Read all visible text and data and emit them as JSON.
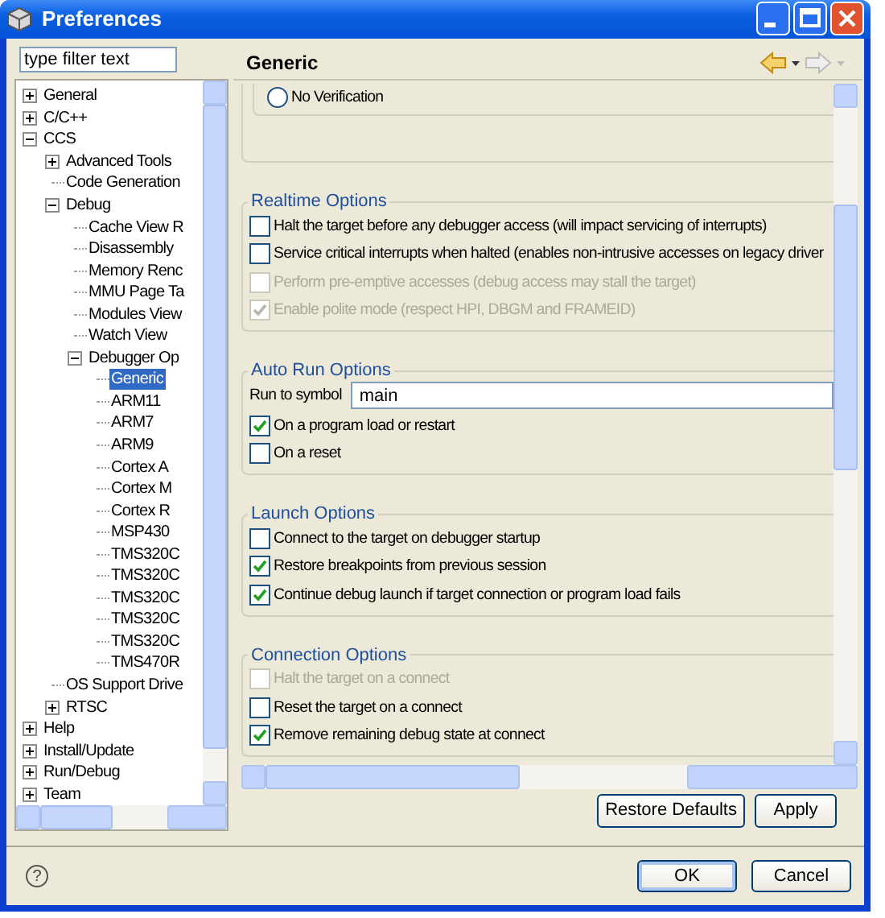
{
  "window": {
    "title": "Preferences"
  },
  "filter": {
    "value": "type filter text"
  },
  "tree": [
    {
      "label": "General",
      "expanded": false,
      "selected": false
    },
    {
      "label": "C/C++",
      "expanded": false,
      "selected": false
    },
    {
      "label": "CCS",
      "expanded": true,
      "selected": false,
      "children": [
        {
          "label": "Advanced Tools",
          "expanded": false,
          "selected": false
        },
        {
          "label": "Code Generation",
          "selected": false
        },
        {
          "label": "Debug",
          "expanded": true,
          "selected": false,
          "children": [
            {
              "label": "Cache View R",
              "selected": false
            },
            {
              "label": "Disassembly",
              "selected": false
            },
            {
              "label": "Memory Renc",
              "selected": false
            },
            {
              "label": "MMU Page Ta",
              "selected": false
            },
            {
              "label": "Modules View",
              "selected": false
            },
            {
              "label": "Watch View",
              "selected": false
            },
            {
              "label": "Debugger Op",
              "expanded": true,
              "selected": false,
              "children": [
                {
                  "label": "Generic",
                  "selected": true
                },
                {
                  "label": "ARM11",
                  "selected": false
                },
                {
                  "label": "ARM7",
                  "selected": false
                },
                {
                  "label": "ARM9",
                  "selected": false
                },
                {
                  "label": "Cortex A",
                  "selected": false
                },
                {
                  "label": "Cortex M",
                  "selected": false
                },
                {
                  "label": "Cortex R",
                  "selected": false
                },
                {
                  "label": "MSP430",
                  "selected": false
                },
                {
                  "label": "TMS320C",
                  "selected": false
                },
                {
                  "label": "TMS320C",
                  "selected": false
                },
                {
                  "label": "TMS320C",
                  "selected": false
                },
                {
                  "label": "TMS320C",
                  "selected": false
                },
                {
                  "label": "TMS320C",
                  "selected": false
                },
                {
                  "label": "TMS470R",
                  "selected": false
                }
              ]
            }
          ]
        },
        {
          "label": "OS Support Drive",
          "selected": false
        },
        {
          "label": "RTSC",
          "expanded": false,
          "selected": false
        }
      ]
    },
    {
      "label": "Help",
      "expanded": false,
      "selected": false
    },
    {
      "label": "Install/Update",
      "expanded": false,
      "selected": false
    },
    {
      "label": "Run/Debug",
      "expanded": false,
      "selected": false
    },
    {
      "label": "Team",
      "expanded": false,
      "selected": false
    }
  ],
  "page": {
    "title": "Generic"
  },
  "groups": [
    {
      "items": [
        {
          "kind": "radio",
          "label": "No Verification",
          "selected": false
        }
      ]
    },
    {
      "title": "Realtime Options",
      "items": [
        {
          "kind": "checkbox",
          "label": "Halt the target before any debugger access (will impact servicing of interrupts)",
          "checked": false,
          "disabled": false
        },
        {
          "kind": "checkbox",
          "label": "Service critical interrupts when halted (enables non-intrusive accesses on legacy driver",
          "checked": false,
          "disabled": false
        },
        {
          "kind": "checkbox",
          "label": "Perform pre-emptive accesses (debug access may stall the target)",
          "checked": false,
          "disabled": true
        },
        {
          "kind": "checkbox",
          "label": "Enable polite mode (respect HPI, DBGM and FRAMEID)",
          "checked": true,
          "disabled": true
        }
      ]
    },
    {
      "title": "Auto Run Options",
      "items": [
        {
          "kind": "field",
          "label": "Run to symbol",
          "value": "main"
        },
        {
          "kind": "checkbox",
          "label": "On a program load or restart",
          "checked": true,
          "disabled": false
        },
        {
          "kind": "checkbox",
          "label": "On a reset",
          "checked": false,
          "disabled": false
        }
      ]
    },
    {
      "title": "Launch Options",
      "items": [
        {
          "kind": "checkbox",
          "label": "Connect to the target on debugger startup",
          "checked": false,
          "disabled": false
        },
        {
          "kind": "checkbox",
          "label": "Restore breakpoints from previous session",
          "checked": true,
          "disabled": false
        },
        {
          "kind": "checkbox",
          "label": "Continue debug launch if target connection or program load fails",
          "checked": true,
          "disabled": false
        }
      ]
    },
    {
      "title": "Connection Options",
      "items": [
        {
          "kind": "checkbox",
          "label": "Halt the target on a connect",
          "checked": false,
          "disabled": true
        },
        {
          "kind": "checkbox",
          "label": "Reset the target on a connect",
          "checked": false,
          "disabled": false
        },
        {
          "kind": "checkbox",
          "label": "Remove remaining debug state at connect",
          "checked": true,
          "disabled": false
        }
      ]
    }
  ],
  "page_buttons": [
    {
      "label": "Restore Defaults",
      "default": false
    },
    {
      "label": "Apply",
      "default": false
    }
  ],
  "help": "?",
  "dialog_buttons": [
    {
      "label": "OK",
      "default": true
    },
    {
      "label": "Cancel",
      "default": false
    }
  ]
}
